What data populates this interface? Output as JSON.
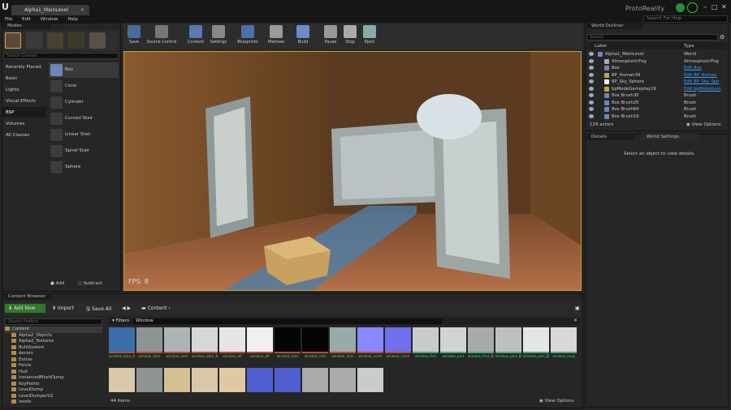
{
  "window": {
    "tab_title": "Alpha1_MainLevel",
    "brand": "ProtoReality",
    "help_placeholder": "Search For Help"
  },
  "menu": [
    "File",
    "Edit",
    "Window",
    "Help"
  ],
  "modes": {
    "tab_label": "Modes",
    "search_placeholder": "Search Classes",
    "categories": [
      "Recently Placed",
      "Basic",
      "Lights",
      "Visual Effects",
      "BSP",
      "Volumes",
      "All Classes"
    ],
    "active_category": "BSP",
    "items": [
      "Box",
      "Cone",
      "Cylinder",
      "Curved Stair",
      "Linear Stair",
      "Spiral Stair",
      "Sphere"
    ],
    "add_label": "Add",
    "subtract_label": "Subtract"
  },
  "toolbar": [
    "Save",
    "Source Control",
    "Content",
    "Settings",
    "Blueprints",
    "Matinee",
    "Build",
    "Pause",
    "Stop",
    "Eject"
  ],
  "viewport": {
    "fps": "FPS: 8"
  },
  "outliner": {
    "tab_label": "World Outliner",
    "search_placeholder": "Search",
    "col_label": "Label",
    "col_type": "Type",
    "rows": [
      {
        "label": "Alpha1_MainLevel",
        "type": "World",
        "link": false
      },
      {
        "label": "AtmosphericFog",
        "type": "AtmosphericFog",
        "link": false
      },
      {
        "label": "Box",
        "type": "Edit Box",
        "link": true
      },
      {
        "label": "BP_Human39",
        "type": "Edit BP_Human",
        "link": true
      },
      {
        "label": "BP_Sky_Sphere",
        "type": "Edit BP_Sky_Sph",
        "link": true
      },
      {
        "label": "bpModeGameplay19",
        "type": "Edit bpModeGam",
        "link": true
      },
      {
        "label": "Box Brush30",
        "type": "Brush",
        "link": false
      },
      {
        "label": "Box Brush25",
        "type": "Brush",
        "link": false
      },
      {
        "label": "Box Brush64",
        "type": "Brush",
        "link": false
      },
      {
        "label": "Box Brush19",
        "type": "Brush",
        "link": false
      }
    ],
    "actor_count": "129 actors",
    "view_options": "View Options"
  },
  "details": {
    "tab_label": "Details",
    "world_settings_tab": "World Settings",
    "empty_text": "Select an object to view details."
  },
  "content_browser": {
    "tab_label": "Content Browser",
    "add_new": "Add New",
    "import": "Import",
    "save_all": "Save All",
    "path": "Content",
    "search_folders_placeholder": "Search Folders",
    "folders": [
      "Content",
      "Alpha2_Objects",
      "Alpha2_Textures",
      "BulbSystem",
      "decors",
      "Extras",
      "Fence",
      "Hud",
      "InstancedMeshDump",
      "KeyPoints",
      "LevelDump",
      "LevelDumperV2",
      "levels"
    ],
    "filters_label": "Filters",
    "filter_chip": "Window",
    "assets": [
      {
        "name": "window_blue",
        "suffix": "_dif"
      },
      {
        "name": "window_dark",
        "suffix": ""
      },
      {
        "name": "window_dark",
        "suffix": ""
      },
      {
        "name": "window_dark",
        "suffix": "_Small"
      },
      {
        "name": "window_dif",
        "suffix": ""
      },
      {
        "name": "window_dif",
        "suffix": ""
      },
      {
        "name": "window_met",
        "suffix": ""
      },
      {
        "name": "window_met",
        "suffix": ""
      },
      {
        "name": "window_mini",
        "suffix": ""
      },
      {
        "name": "window_norm",
        "suffix": ""
      },
      {
        "name": "window_norm",
        "suffix": ""
      },
      {
        "name": "window_Part",
        "suffix": ""
      },
      {
        "name": "window_part",
        "suffix": ""
      },
      {
        "name": "window_Part",
        "suffix": "_DM"
      },
      {
        "name": "window_part",
        "suffix": "_DM"
      },
      {
        "name": "window_part",
        "suffix": "_DM_DLF"
      },
      {
        "name": "window_roug",
        "suffix": ""
      }
    ],
    "item_count": "44 items",
    "view_options": "View Options"
  }
}
